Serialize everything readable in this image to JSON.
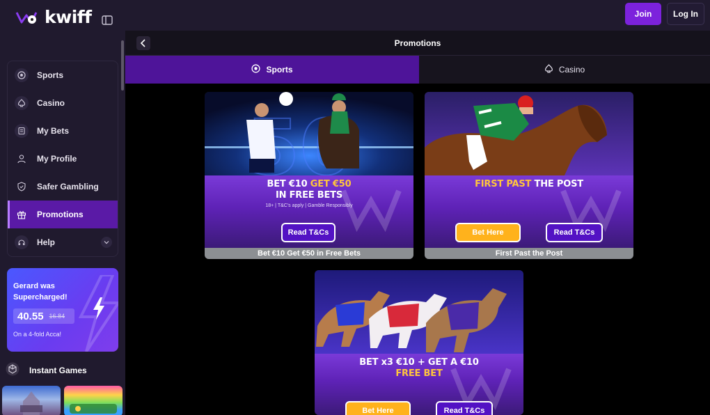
{
  "brand": {
    "name": "kwiff"
  },
  "header": {
    "join_label": "Join",
    "login_label": "Log In"
  },
  "sidebar": {
    "items": [
      {
        "label": "Sports",
        "icon": "soccer-ball-icon",
        "active": false
      },
      {
        "label": "Casino",
        "icon": "spade-icon",
        "active": false
      },
      {
        "label": "My Bets",
        "icon": "betslip-icon",
        "active": false
      },
      {
        "label": "My Profile",
        "icon": "user-icon",
        "active": false
      },
      {
        "label": "Safer Gambling",
        "icon": "shield-icon",
        "active": false
      },
      {
        "label": "Promotions",
        "icon": "gift-icon",
        "active": true
      },
      {
        "label": "Help",
        "icon": "help-icon",
        "active": false
      }
    ],
    "supercharged": {
      "title": "Gerard was Supercharged!",
      "new_odds": "40.55",
      "old_odds": "16.84",
      "subtitle": "On a 4-fold Acca!"
    },
    "instant_games_label": "Instant Games"
  },
  "page": {
    "title": "Promotions"
  },
  "tabs": [
    {
      "label": "Sports",
      "icon": "soccer-ball-icon",
      "active": true
    },
    {
      "label": "Casino",
      "icon": "spade-icon",
      "active": false
    }
  ],
  "promos": [
    {
      "headline_line1_white": "BET €10 ",
      "headline_line1_gold": "GET €50",
      "headline_line2": "IN FREE BETS",
      "note": "18+ | T&C's apply | Gamble Responsibly",
      "read_label": "Read T&Cs",
      "caption": "Bet €10 Get €50 in Free Bets"
    },
    {
      "headline_gold": "FIRST PAST ",
      "headline_white": "THE POST",
      "bet_label": "Bet Here",
      "read_label": "Read T&Cs",
      "caption": "First Past the Post"
    },
    {
      "headline_line1": "BET x3 €10 + GET A €10",
      "headline_line2": "FREE BET",
      "bet_label": "Bet Here",
      "read_label": "Read T&Cs"
    }
  ],
  "colors": {
    "accent": "#7c22dc",
    "active_tab": "#4e1499",
    "gold": "#ffc53d",
    "bet_button": "#ffb21c",
    "sidebar_bg": "#201a2e"
  }
}
